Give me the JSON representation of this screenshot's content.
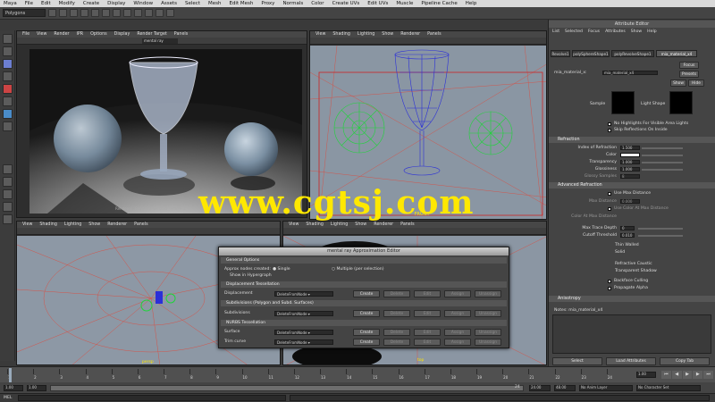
{
  "menubar": [
    "Maya",
    "File",
    "Edit",
    "Modify",
    "Create",
    "Display",
    "Window",
    "Assets",
    "Select",
    "Mesh",
    "Edit Mesh",
    "Proxy",
    "Normals",
    "Color",
    "Create UVs",
    "Edit UVs",
    "Muscle",
    "Pipeline Cache",
    "Help"
  ],
  "status": {
    "mode": "Polygons"
  },
  "viewports": {
    "menu": [
      "View",
      "Shading",
      "Lighting",
      "Show",
      "Renderer",
      "Panels"
    ],
    "render_view_menu": [
      "File",
      "View",
      "Render",
      "IPR",
      "Options",
      "Display",
      "Render Target",
      "Panels"
    ],
    "render_target": "mental ray",
    "render_info": [
      "Renderer",
      "Render time: 0:15",
      "Frame 1"
    ],
    "persp_label": "FRONT",
    "bottom_label": "persp",
    "side_label": "top"
  },
  "attribute_editor": {
    "title": "Attribute Editor",
    "menu": [
      "List",
      "Selected",
      "Focus",
      "Attributes",
      "Show",
      "Help"
    ],
    "tabs": [
      "Revolve1",
      "polySphereShape1",
      "polyRevolveShape1",
      "mia_material_x4"
    ],
    "type_label": "mia_material_x:",
    "name_value": "mia_material_x4",
    "focus": "Focus",
    "presets": "Presets",
    "show": "Show",
    "hide": "Hide",
    "sample_label": "Sample",
    "light_shape_label": "Light Shape",
    "no_highlights": "No Highlights For Visible Area Lights",
    "skip_reflections": "Skip Reflections On Inside",
    "refraction_section": "Refraction",
    "ior_label": "Index of Refraction",
    "ior_value": "1.500",
    "color_label": "Color",
    "transparency_label": "Transparency",
    "transparency_value": "1.000",
    "glossiness_label": "Glossiness",
    "glossiness_value": "1.000",
    "glossy_samples_label": "Glossy Samples",
    "glossy_samples_value": "8",
    "adv_refraction": "Advanced Refraction",
    "use_max_distance": "Use Max Distance",
    "max_distance": "Max Distance",
    "max_distance_value": "0.000",
    "use_color_at_max": "Use Color At Max Distance",
    "color_at_max": "Color At Max Distance",
    "max_trace_depth": "Max Trace Depth",
    "max_trace_depth_value": "0",
    "cutoff_threshold": "Cutoff Threshold",
    "cutoff_value": "0.010",
    "thin_walled": "Thin Walled",
    "solid": "Solid",
    "refractive_caustic": "Refractive Caustic",
    "transparent_shadow": "Transparent Shadow",
    "backface_culling": "Backface Culling",
    "propagate_alpha": "Propagate Alpha",
    "anisotropy": "Anisotropy",
    "notes": "Notes: mia_material_x4",
    "btn_select": "Select",
    "btn_load": "Load Attributes",
    "btn_copy": "Copy Tab"
  },
  "dialog": {
    "title": "mental ray Approximation Editor",
    "general_options": "General Options",
    "approx_nodes_label": "Approx nodes created:",
    "single": "Single",
    "multiple": "Multiple (per selection)",
    "show_in_hypergraph": "Show in Hypergraph",
    "displacement_tess": "Displacement Tessellation",
    "displacement": "Displacement",
    "subdiv_tess": "Subdivisions (Polygon and Subd. Surfaces)",
    "subdivisions": "Subdivisions",
    "nurbs_tess": "NURBS Tessellation",
    "surface": "Surface",
    "trim_curve": "Trim curve",
    "default_value": "DeleteFromNode",
    "buttons": [
      "Create",
      "Delete",
      "Edit",
      "Assign",
      "Unassign"
    ]
  },
  "watermark": "www.cgtsj.com",
  "timeline": {
    "ticks": [
      "1",
      "2",
      "3",
      "4",
      "5",
      "6",
      "7",
      "8",
      "9",
      "10",
      "11",
      "12",
      "13",
      "14",
      "15",
      "16",
      "17",
      "18",
      "19",
      "20",
      "21",
      "22",
      "23",
      "24"
    ],
    "current": "1.00"
  },
  "range": {
    "start": "1.00",
    "inner_start": "1.00",
    "inner_end": "24",
    "end_a": "24.00",
    "end_b": "48.00",
    "anim_layer": "No Anim Layer",
    "char_set": "No Character Set"
  },
  "cmdline": {
    "label": "MEL"
  },
  "colors": {
    "accent": "#ffe800",
    "wire_green": "#1fd43a",
    "wire_blue": "#2b2fd8",
    "wire_red": "#e0483a"
  }
}
